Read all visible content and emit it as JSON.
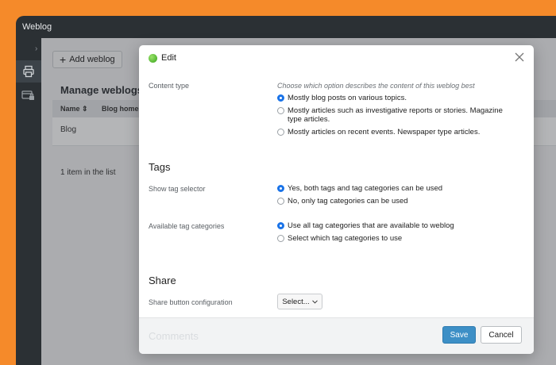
{
  "app": {
    "title": "Weblog"
  },
  "toolbar": {
    "add_label": "Add weblog"
  },
  "page": {
    "title": "Manage weblogs",
    "columns": [
      "Name",
      "Blog homep"
    ],
    "rows": [
      "Blog"
    ],
    "count": "1 item in the list"
  },
  "dialog": {
    "title": "Edit",
    "content_type": {
      "label": "Content type",
      "hint": "Choose which option describes the content of this weblog best",
      "options": [
        "Mostly blog posts on various topics.",
        "Mostly articles such as investigative reports or stories. Magazine type articles.",
        "Mostly articles on recent events. Newspaper type articles."
      ],
      "selected": 0
    },
    "tags": {
      "heading": "Tags",
      "selector_label": "Show tag selector",
      "selector_options": [
        "Yes, both tags and tag categories can be used",
        "No, only tag categories can be used"
      ],
      "categories_label": "Available tag categories",
      "categories_options": [
        "Use all tag categories that are available to weblog",
        "Select which tag categories to use"
      ]
    },
    "share": {
      "heading": "Share",
      "config_label": "Share button configuration",
      "select_value": "Select..."
    },
    "next_section": "Comments",
    "save_label": "Save",
    "cancel_label": "Cancel"
  },
  "colors": {
    "accent": "#1a73e8",
    "save": "#3d8fc6",
    "background": "#f58a2a"
  }
}
